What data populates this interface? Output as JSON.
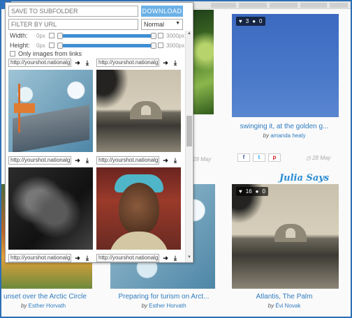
{
  "popup": {
    "subfolder_placeholder": "SAVE TO SUBFOLDER",
    "download_label": "DOWNLOAD",
    "filter_placeholder": "FILTER BY URL",
    "filter_mode": "Normal",
    "width_label": "Width:",
    "height_label": "Height:",
    "min_label": "0px",
    "max_label": "3000px",
    "only_links_label": "Only images from links",
    "url_prefix": "http://yourshot.nationalg",
    "open_icon": "arrow-right-icon",
    "download_icon": "download-icon"
  },
  "page": {
    "cards": [
      {
        "title": "swinging it, at the golden g...",
        "author": "amanda healy",
        "date": "28 May",
        "likes": "3",
        "comments": "0"
      },
      {
        "title": "Atlantis, The Palm",
        "author": "Évi Novak",
        "likes": "16",
        "comments": "0"
      },
      {
        "title": "Preparing for turism on Arct...",
        "author": "Esther Horvath"
      },
      {
        "title": "unset over the Arctic Circle",
        "author": "Esther Horvath"
      }
    ],
    "by_label": "by",
    "middle_date": "28 May",
    "watermark": "Julia Says",
    "share": {
      "facebook": "f",
      "twitter": "t",
      "pinterest": "p"
    }
  }
}
